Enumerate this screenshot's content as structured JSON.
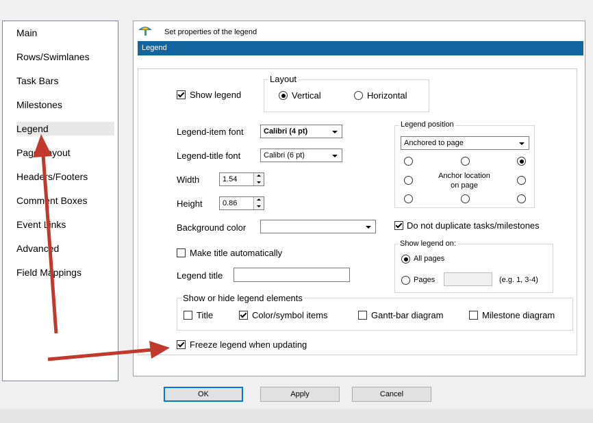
{
  "nav": {
    "items": [
      {
        "label": "Main"
      },
      {
        "label": "Rows/Swimlanes"
      },
      {
        "label": "Task Bars"
      },
      {
        "label": "Milestones"
      },
      {
        "label": "Legend"
      },
      {
        "label": "Page Layout"
      },
      {
        "label": "Headers/Footers"
      },
      {
        "label": "Comment Boxes"
      },
      {
        "label": "Event Links"
      },
      {
        "label": "Advanced"
      },
      {
        "label": "Field Mappings"
      }
    ],
    "selected": "Legend"
  },
  "header": {
    "title": "Set properties of the legend",
    "section": "Legend",
    "section_bar_color": "#1365a0"
  },
  "show_legend": {
    "label": "Show legend",
    "checked": true
  },
  "layout": {
    "title": "Layout",
    "vertical_label": "Vertical",
    "horizontal_label": "Horizontal",
    "selected": "Vertical"
  },
  "fonts": {
    "item_label": "Legend-item font",
    "item_value": "Calibri (4 pt)",
    "title_label": "Legend-title font",
    "title_value": "Calibri (6 pt)"
  },
  "size": {
    "width_label": "Width",
    "width_value": "1.54",
    "height_label": "Height",
    "height_value": "0.86"
  },
  "background": {
    "label": "Background color",
    "value": ""
  },
  "make_title": {
    "label": "Make title automatically",
    "checked": false
  },
  "legend_title": {
    "label": "Legend title",
    "value": ""
  },
  "position": {
    "title": "Legend position",
    "value": "Anchored to page",
    "anchor_label_line1": "Anchor location",
    "anchor_label_line2": "on page",
    "selected_anchor": "top-right"
  },
  "no_duplicate": {
    "label": "Do not duplicate tasks/milestones",
    "checked": true
  },
  "show_on": {
    "title": "Show legend on:",
    "all_label": "All pages",
    "pages_label": "Pages",
    "pages_value": "",
    "example": "(e.g. 1, 3-4)",
    "selected": "All pages"
  },
  "elements": {
    "title": "Show or hide legend elements",
    "title_item": {
      "label": "Title",
      "checked": false
    },
    "color_item": {
      "label": "Color/symbol items",
      "checked": true
    },
    "gantt_item": {
      "label": "Gantt-bar diagram",
      "checked": false
    },
    "milestone_item": {
      "label": "Milestone diagram",
      "checked": false
    }
  },
  "freeze": {
    "label": "Freeze legend when updating",
    "checked": true
  },
  "buttons": {
    "ok": "OK",
    "apply": "Apply",
    "cancel": "Cancel"
  },
  "annotation": {
    "arrow_color": "#c0392b"
  }
}
